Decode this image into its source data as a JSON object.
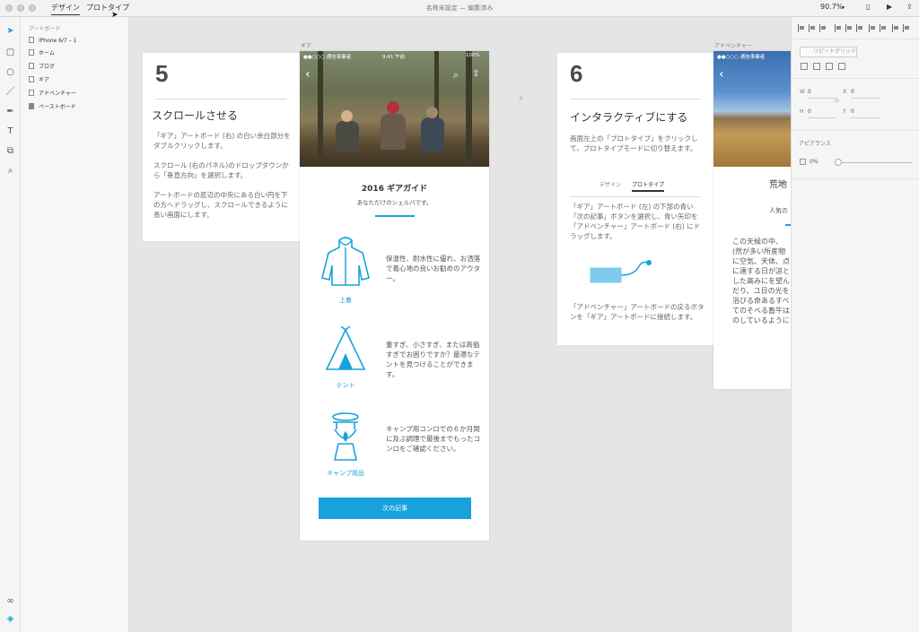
{
  "titlebar": {
    "tabs": [
      "デザイン",
      "プロトタイプ"
    ],
    "doc_title": "名称未設定 — 編集済み",
    "zoom": "90.7%"
  },
  "tools": [
    "select-icon",
    "rectangle-icon",
    "ellipse-icon",
    "line-icon",
    "pen-icon",
    "text-icon",
    "artboard-icon",
    "zoom-icon",
    "link-icon",
    "layers-icon"
  ],
  "layers": {
    "header": "アートボード",
    "items": [
      "iPhone 6/7 – 1",
      "ホーム",
      "ブログ",
      "ギア",
      "アドベンチャー",
      "ペーストボード"
    ]
  },
  "canvas": {
    "label_gear": "ギア",
    "label_adventure": "アドベンチャー",
    "step5": {
      "number": "5",
      "title": "スクロールさせる",
      "p1": "「ギア」アートボード (右) の白い余白部分をダブルクリックします。",
      "p2": "スクロール (右のパネル)のドロップダウンから「垂直方向」を選択します。",
      "p3": "アートボードの底辺の中央にある白い円を下の方へドラッグし、スクロールできるように長い画面にします。"
    },
    "gear_phone": {
      "status_carrier": "●●○○○ 通信事業者",
      "status_time": "9:41 午前",
      "status_battery": "100%",
      "title": "2016 ギアガイド",
      "subtitle": "あなただけのシェルパです。",
      "items": [
        {
          "label": "上着",
          "text": "保温性、耐水性に優れ、お洒落で着心地の良いお勧めのアウター。"
        },
        {
          "label": "テント",
          "text": "重すぎ、小さすぎ、または高価すぎでお困りですか？最適なテントを見つけることができます。"
        },
        {
          "label": "キャンプ用品",
          "text": "キャンプ用コンロでの６か月間に及ぶ調理で最後までもったコンロをご確認ください。"
        }
      ],
      "button": "次の記事"
    },
    "step6": {
      "number": "6",
      "title": "インタラクティブにする",
      "p1": "画面左上の「プロトタイプ」をクリックして、プロトタイプモードに切り替えます。",
      "tab_design": "デザイン",
      "tab_proto": "プロトタイプ",
      "p2": "「ギア」アートボード (左) の下部の青い「次の記事」ボタンを選択し、青い矢印を「アドベンチャー」アートボード (右) にドラッグします。",
      "p3": "「アドベンチャー」アートボードの戻るボタンを「ギア」アートボードに接続します。"
    },
    "adv_phone": {
      "status_carrier": "●●○○○ 通信事業者",
      "title": "荒地",
      "subtitle": "人気の",
      "text": "この天候の中、(然が多い所産物に空気、天体、点に達する日が涼とした高みにを望んだり、ユ日の光を浴びる命あるすべてのそべる畜牛はのしているように"
    }
  },
  "rpanel": {
    "repeat_grid": "リピートグリッド",
    "w_label": "W",
    "w_value": "0",
    "h_label": "H",
    "h_value": "0",
    "x_label": "X",
    "x_value": "0",
    "y_label": "Y",
    "y_value": "0",
    "appearance": "アピアランス",
    "opacity": "0%"
  },
  "colors": {
    "accent": "#18a2dc",
    "panel": "#f5f5f5",
    "canvas": "#e5e5e5"
  }
}
